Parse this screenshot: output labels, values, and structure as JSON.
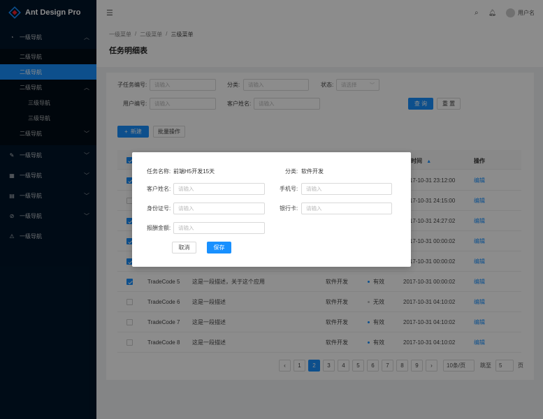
{
  "app": {
    "title": "Ant Design Pro"
  },
  "sidebar": {
    "items": [
      {
        "label": "一级导航",
        "icon": "dashboard-icon",
        "expanded": true
      },
      {
        "label": "二级导航"
      },
      {
        "label": "二级导航",
        "active": true
      },
      {
        "label": "二级导航",
        "expanded": true
      },
      {
        "label": "三级导航"
      },
      {
        "label": "三级导航"
      },
      {
        "label": "二级导航"
      },
      {
        "label": "一级导航",
        "icon": "edit-icon"
      },
      {
        "label": "一级导航",
        "icon": "table-icon"
      },
      {
        "label": "一级导航",
        "icon": "profile-icon"
      },
      {
        "label": "一级导航",
        "icon": "check-circle-icon"
      },
      {
        "label": "一级导航",
        "icon": "warning-icon"
      }
    ]
  },
  "header": {
    "username": "用户名"
  },
  "breadcrumb": [
    "一级菜单",
    "二级菜单",
    "三级菜单"
  ],
  "page_title": "任务明细表",
  "filters": {
    "subtask_label": "子任务编号:",
    "subtask_placeholder": "请输入",
    "category_label": "分类:",
    "category_placeholder": "请输入",
    "status_label": "状态:",
    "status_placeholder": "请选择",
    "user_label": "用户编号:",
    "user_placeholder": "请输入",
    "customer_label": "客户姓名:",
    "customer_placeholder": "请输入",
    "query_button": "查 询",
    "reset_button": "重 置"
  },
  "toolbar": {
    "new_button": "新建",
    "batch_button": "批量操作"
  },
  "table": {
    "col_time": "时间",
    "col_action": "操作",
    "rows": [
      {
        "code": "",
        "desc": "",
        "cat": "",
        "status": "",
        "time": "2017-10-31  23:12:00",
        "action": "编辑",
        "checked": true
      },
      {
        "code": "",
        "desc": "",
        "cat": "",
        "status": "",
        "time": "2017-10-31  24:15:00",
        "action": "编辑",
        "checked": false
      },
      {
        "code": "",
        "desc": "",
        "cat": "",
        "status": "",
        "time": "2017-10-31  24:27:02",
        "action": "编辑",
        "checked": true
      },
      {
        "code": "",
        "desc": "",
        "cat": "",
        "status": "",
        "time": "2017-10-31  00:00:02",
        "action": "编辑",
        "checked": true
      },
      {
        "code": "",
        "desc": "",
        "cat": "",
        "status": "",
        "time": "2017-10-31  00:00:02",
        "action": "编辑",
        "checked": true
      },
      {
        "code": "TradeCode 5",
        "desc": "这是一段描述，关于这个应用",
        "cat": "软件开发",
        "status": "有效",
        "time": "2017-10-31  00:00:02",
        "action": "编辑",
        "checked": true,
        "active": true
      },
      {
        "code": "TradeCode 6",
        "desc": "这是一段描述",
        "cat": "软件开发",
        "status": "无效",
        "time": "2017-10-31  04:10:02",
        "action": "编辑",
        "checked": false,
        "active": false
      },
      {
        "code": "TradeCode 7",
        "desc": "这是一段描述",
        "cat": "软件开发",
        "status": "有效",
        "time": "2017-10-31  04:10:02",
        "action": "编辑",
        "checked": false,
        "active": true
      },
      {
        "code": "TradeCode 8",
        "desc": "这是一段描述",
        "cat": "软件开发",
        "status": "有效",
        "time": "2017-10-31  04:10:02",
        "action": "编辑",
        "checked": false,
        "active": true
      }
    ]
  },
  "pagination": {
    "prev": "‹",
    "next": "›",
    "pages": [
      "1",
      "2",
      "3",
      "4",
      "5",
      "6",
      "7",
      "8",
      "9"
    ],
    "current": "2",
    "page_size": "10条/页",
    "jump_label": "跳至",
    "jump_value": "5",
    "jump_unit": "页"
  },
  "modal": {
    "task_label": "任务名称:",
    "task_value": "前端H5开发15天",
    "category_label": "分类:",
    "category_value": "软件开发",
    "customer_label": "客户姓名:",
    "customer_placeholder": "请输入",
    "phone_label": "手机号:",
    "phone_placeholder": "请输入",
    "id_label": "身份证号:",
    "id_placeholder": "请输入",
    "bank_label": "银行卡:",
    "bank_placeholder": "请输入",
    "amount_label": "报酬金额:",
    "amount_placeholder": "请输入",
    "cancel_button": "取消",
    "save_button": "保存"
  },
  "colors": {
    "primary": "#1890ff",
    "sidebar": "#001529"
  }
}
